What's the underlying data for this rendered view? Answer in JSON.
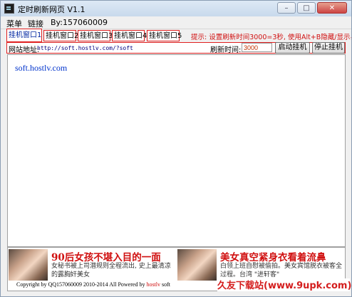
{
  "window": {
    "title": "定时刷新网页 V1.1",
    "minimize_symbol": "–",
    "maximize_symbol": "□",
    "close_symbol": "✕"
  },
  "menu": {
    "items": [
      "菜单",
      "链接",
      "By:157060009"
    ]
  },
  "tabs": [
    "挂机窗口1",
    "挂机窗口2",
    "挂机窗口3",
    "挂机窗口4",
    "挂机窗口5"
  ],
  "active_tab": "挂机窗口1",
  "hint": "提示: 设置刷新时间3000=3秒, 使用Alt+B隐藏/显示界面",
  "address": {
    "label": "网站地址:",
    "value": "http://soft.hostlv.com/?soft"
  },
  "interval": {
    "label": "刷新时间:",
    "value": "3000"
  },
  "buttons": {
    "start": "启动挂机",
    "stop": "停止挂机"
  },
  "page": {
    "link_text": "soft.hostlv.com"
  },
  "ads": [
    {
      "headline": "90后女孩不堪入目的一面",
      "desc": "女秘书被上司潜规则全程流出, 史上最清凉的露胸奸美女"
    },
    {
      "headline": "美女真空紧身衣看着流鼻",
      "desc": "白领上班自慰被偷拍。美女宾馆脱衣被客全过程。台湾 \"进轩客\""
    }
  ],
  "footer": {
    "text": "Copyright by QQ157060009 2010-2014 All Powered by ",
    "brand": "hostlv",
    "tail": " soft"
  },
  "watermark": "久友下载站(www.9upk.com)",
  "colors": {
    "accent_red": "#e02020",
    "link_blue": "#0033cc",
    "tab_active_text": "#0026a0"
  }
}
